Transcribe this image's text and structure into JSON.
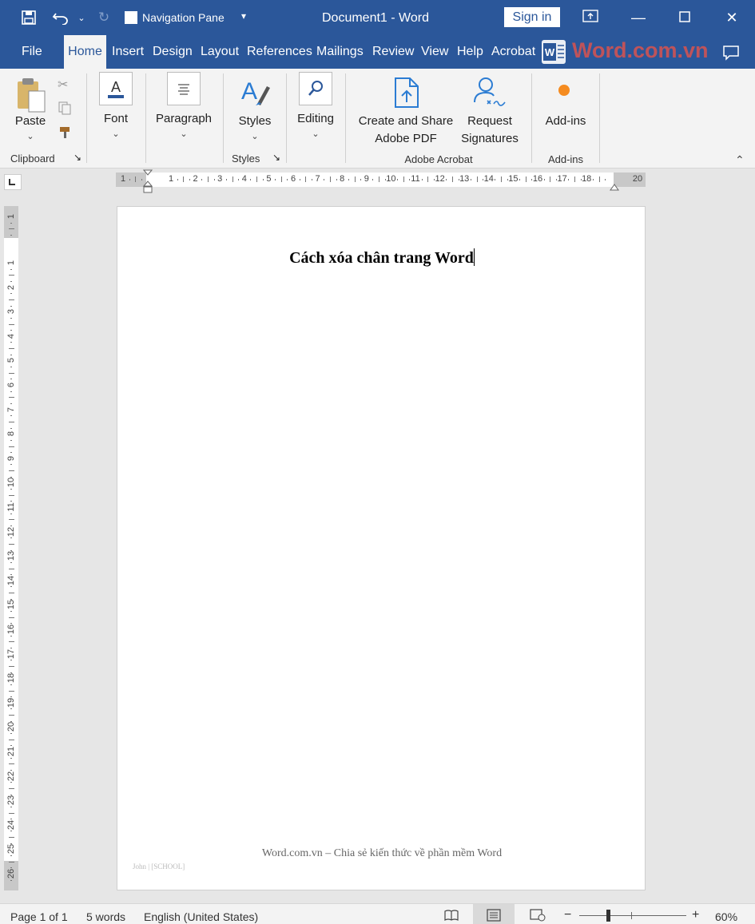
{
  "titlebar": {
    "nav_pane_label": "Navigation Pane",
    "document_title": "Document1  -  Word",
    "sign_in_label": "Sign in"
  },
  "tabs": [
    {
      "label": "File"
    },
    {
      "label": "Home"
    },
    {
      "label": "Insert"
    },
    {
      "label": "Design"
    },
    {
      "label": "Layout"
    },
    {
      "label": "References"
    },
    {
      "label": "Mailings"
    },
    {
      "label": "Review"
    },
    {
      "label": "View"
    },
    {
      "label": "Help"
    },
    {
      "label": "Acrobat"
    }
  ],
  "watermark": {
    "text": "Word.com.vn"
  },
  "ribbon": {
    "paste": "Paste",
    "clipboard_group": "Clipboard",
    "font": "Font",
    "paragraph": "Paragraph",
    "styles": "Styles",
    "styles_group": "Styles",
    "editing": "Editing",
    "create_share_line1": "Create and Share",
    "create_share_line2": "Adobe PDF",
    "request_line1": "Request",
    "request_line2": "Signatures",
    "acrobat_group": "Adobe Acrobat",
    "addins": "Add-ins",
    "addins_group": "Add-ins"
  },
  "ruler": {
    "h_ticks": [
      "1",
      "1",
      "2",
      "3",
      "4",
      "5",
      "6",
      "7",
      "8",
      "9",
      "10",
      "11",
      "12",
      "13",
      "14",
      "15",
      "16",
      "17",
      "18",
      "20"
    ],
    "v_ticks": [
      "1",
      "1",
      "2",
      "3",
      "4",
      "5",
      "6",
      "7",
      "8",
      "9",
      "10",
      "11",
      "12",
      "13",
      "14",
      "15",
      "16",
      "17",
      "18",
      "19",
      "20",
      "21",
      "22",
      "23",
      "24",
      "25",
      "26"
    ]
  },
  "document": {
    "heading": "Cách xóa chân trang Word",
    "footer_text": "Word.com.vn – Chia sẻ kiến thức về phần mềm Word",
    "footer_small": "John | [SCHOOL]"
  },
  "status": {
    "page": "Page 1 of 1",
    "words": "5 words",
    "language": "English (United States)",
    "zoom": "60%",
    "zoom_minus": "−",
    "zoom_plus": "+"
  },
  "colors": {
    "brand": "#2b579a",
    "ribbon_bg": "#f3f3f3",
    "watermark_red": "#d9534f"
  }
}
